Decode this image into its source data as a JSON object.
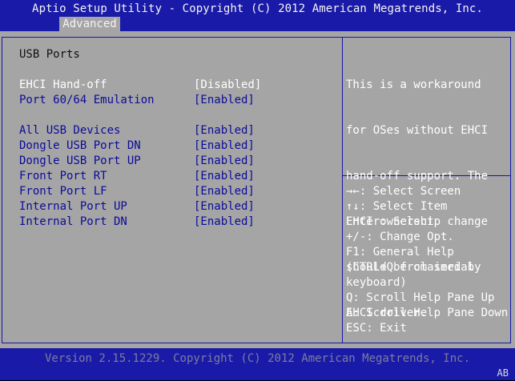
{
  "header": {
    "title": "Aptio Setup Utility - Copyright (C) 2012 American Megatrends, Inc.",
    "active_tab": "Advanced"
  },
  "main": {
    "section_title": "USB Ports",
    "items": [
      {
        "label": "EHCI Hand-off",
        "value": "[Disabled]",
        "selected": true
      },
      {
        "label": "Port 60/64 Emulation",
        "value": "[Enabled]"
      },
      {
        "label": "All USB Devices",
        "value": "[Enabled]"
      },
      {
        "label": "Dongle USB Port DN",
        "value": "[Enabled]"
      },
      {
        "label": "Dongle USB Port UP",
        "value": "[Enabled]"
      },
      {
        "label": "Front Port RT",
        "value": "[Enabled]"
      },
      {
        "label": "Front Port LF",
        "value": "[Enabled]"
      },
      {
        "label": "Internal Port UP",
        "value": "[Enabled]"
      },
      {
        "label": "Internal Port DN",
        "value": "[Enabled]"
      }
    ]
  },
  "help": {
    "lines": [
      "This is a workaround",
      "for OSes without EHCI",
      "hand-off support. The",
      "EHCI ownership change",
      "should be claimed by",
      "EHCI driver."
    ]
  },
  "keys": [
    "→←: Select Screen",
    "↑↓: Select Item",
    "Enter: Select",
    "+/-: Change Opt.",
    "F1: General Help",
    "(CTRL+Q from serial",
    "keyboard)",
    "Q: Scroll Help Pane Up",
    "A: Scroll Help Pane Down",
    "ESC: Exit"
  ],
  "footer": {
    "version": "Version 2.15.1229. Copyright (C) 2012 American Megatrends, Inc.",
    "corner_code": "AB"
  },
  "colors": {
    "bar_blue": "#1a1aa8",
    "panel_gray": "#a5a5a5",
    "item_text": "#0b0b9b",
    "selected_text": "#ffffff"
  }
}
